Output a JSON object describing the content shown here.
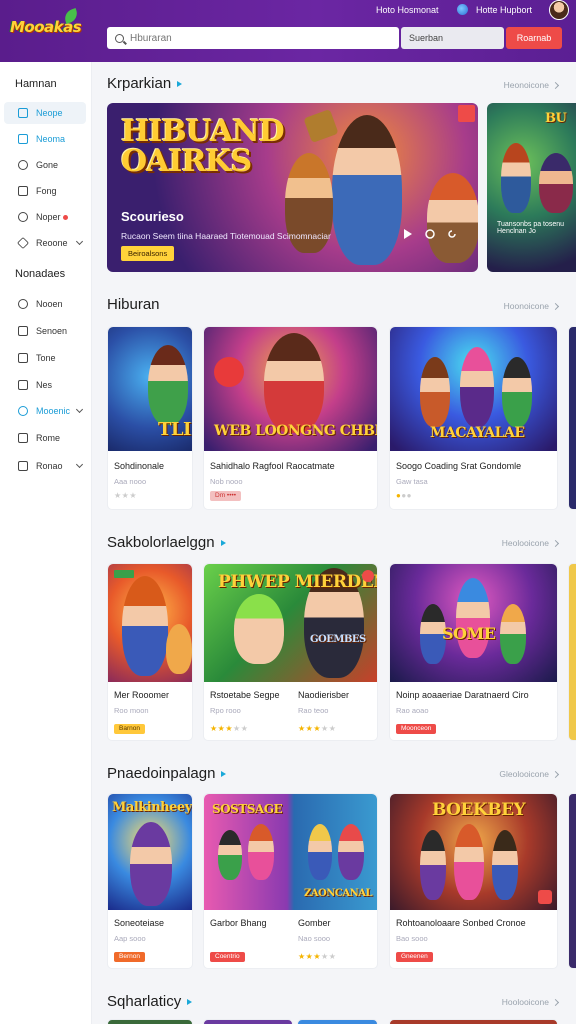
{
  "header": {
    "logo_text": "Mooakas",
    "nav_a": "Hoto Hosmonat",
    "nav_b": "Hotte Hupbort",
    "search_placeholder": "Hburaran",
    "search_secondary": "Suerban",
    "button_label": "Roarnab"
  },
  "sidebar": {
    "heading_1": "Hamnan",
    "items_1": [
      {
        "label": "Neope",
        "icon": "home-icon"
      },
      {
        "label": "Neoma",
        "icon": "tv-icon"
      },
      {
        "label": "Gone",
        "icon": "search-icon"
      },
      {
        "label": "Fong",
        "icon": "bookmark-icon"
      },
      {
        "label": "Noper",
        "icon": "clock-icon"
      },
      {
        "label": "Reoone",
        "icon": "tag-icon"
      }
    ],
    "heading_2": "Nonadaes",
    "items_2": [
      {
        "label": "Nooen",
        "icon": "user-icon"
      },
      {
        "label": "Senoen",
        "icon": "grid-icon"
      },
      {
        "label": "Tone",
        "icon": "folder-icon"
      },
      {
        "label": "Nes",
        "icon": "chat-icon"
      },
      {
        "label": "Mooenic",
        "icon": "globe-icon"
      },
      {
        "label": "Rome",
        "icon": "square-icon"
      },
      {
        "label": "Ronao",
        "icon": "list-icon"
      }
    ]
  },
  "sections": {
    "s1": {
      "title": "Krparkian",
      "link": "Heonoicone"
    },
    "s2": {
      "title": "Hiburan",
      "link": "Hoonoicone"
    },
    "s3": {
      "title": "Sakbolorlaelggn",
      "link": "Heolooicone"
    },
    "s4": {
      "title": "Pnaedoinpalagn",
      "link": "Gleolooicone"
    },
    "s5": {
      "title": "Sqharlaticy",
      "link": "Hoolooicone"
    }
  },
  "hero": {
    "logo": "HIBUAND OAIRKS",
    "subtitle": "Scourieso",
    "desc": "Rucaon Seem tiina Haaraed Tiotemouad Scimomnaciar",
    "button": "Beiroalsons",
    "side_desc": "Tuansonbs pa tosenu Henclnan Jo"
  },
  "row1": [
    {
      "title": "Sohdinonale",
      "meta": "Aaa nooo",
      "img_text": "TLIK"
    },
    {
      "title": "Sahidhalo Ragfool Raocatmate",
      "meta": "Nob nooo",
      "img_text": "WEB LOONGNG CHBEI"
    },
    {
      "title": "Soogo Coading Srat Gondomle",
      "meta": "Gaw tasa",
      "img_text": "MACAYALAE"
    }
  ],
  "row2": [
    {
      "title": "Mer Rooomer",
      "meta": "Roo moon",
      "tag": "Barnon",
      "img_text": ""
    },
    {
      "title": "Rstoetabe Segpe",
      "meta": "Rpo rooo",
      "img_text": "PHWEP MIERDEN"
    },
    {
      "title": "Naodierisber",
      "meta": "Rao teoo",
      "img_text": "GOEMBES"
    },
    {
      "title": "Noinp aoaaeriae Daratnaerd Ciro",
      "meta": "Rao aoao",
      "tag": "Moonceon",
      "img_text": "SOME"
    }
  ],
  "row3": [
    {
      "title": "Soneoteiase",
      "meta": "Aap sooo",
      "tag": "Bernon",
      "img_text": "Malkinheey"
    },
    {
      "title": "Garbor Bhang",
      "meta": "Gao nooo",
      "tag": "Coentrio",
      "img_text": "SOSTSAGE"
    },
    {
      "title": "Gomber",
      "meta": "Nao sooo",
      "img_text": "ZAONCANAL"
    },
    {
      "title": "Rohtoanoloaare Sonbed Cronoe",
      "meta": "Bao sooo",
      "tag": "Gneenen",
      "img_text": "BOEKBEY"
    }
  ],
  "colors": {
    "header_bg": "#5a1d8c",
    "accent": "#1aa8d8",
    "danger": "#ee4b48",
    "gold": "#ffd23a"
  }
}
